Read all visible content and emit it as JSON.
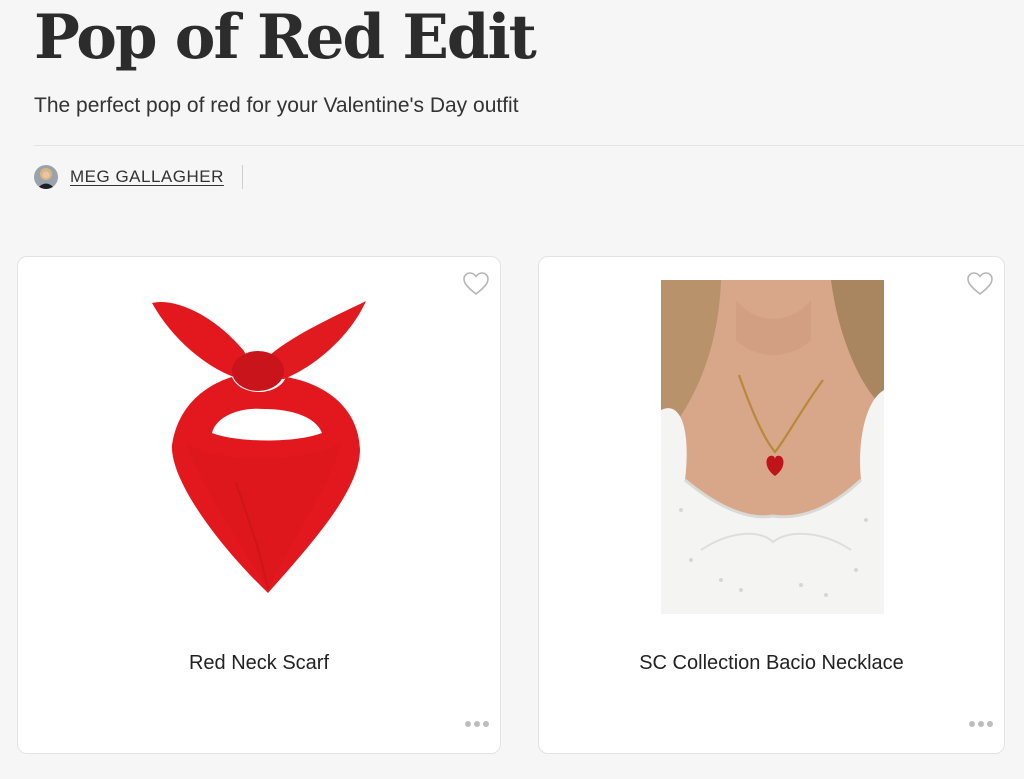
{
  "page": {
    "title": "Pop of Red Edit",
    "subtitle": "The perfect pop of red for your Valentine's Day outfit"
  },
  "author": {
    "name": "MEG GALLAGHER",
    "avatar_icon": "avatar-photo"
  },
  "products": [
    {
      "name": "Red Neck Scarf",
      "image_icon": "red-neck-scarf-image",
      "favorite_icon": "heart-outline-icon",
      "more_icon": "more-dots-icon"
    },
    {
      "name": "SC Collection Bacio Necklace",
      "image_icon": "heart-necklace-photo",
      "favorite_icon": "heart-outline-icon",
      "more_icon": "more-dots-icon"
    }
  ],
  "colors": {
    "background": "#f6f6f6",
    "card": "#ffffff",
    "accent_red": "#e3181f",
    "icon_gray": "#b5b5b5"
  }
}
